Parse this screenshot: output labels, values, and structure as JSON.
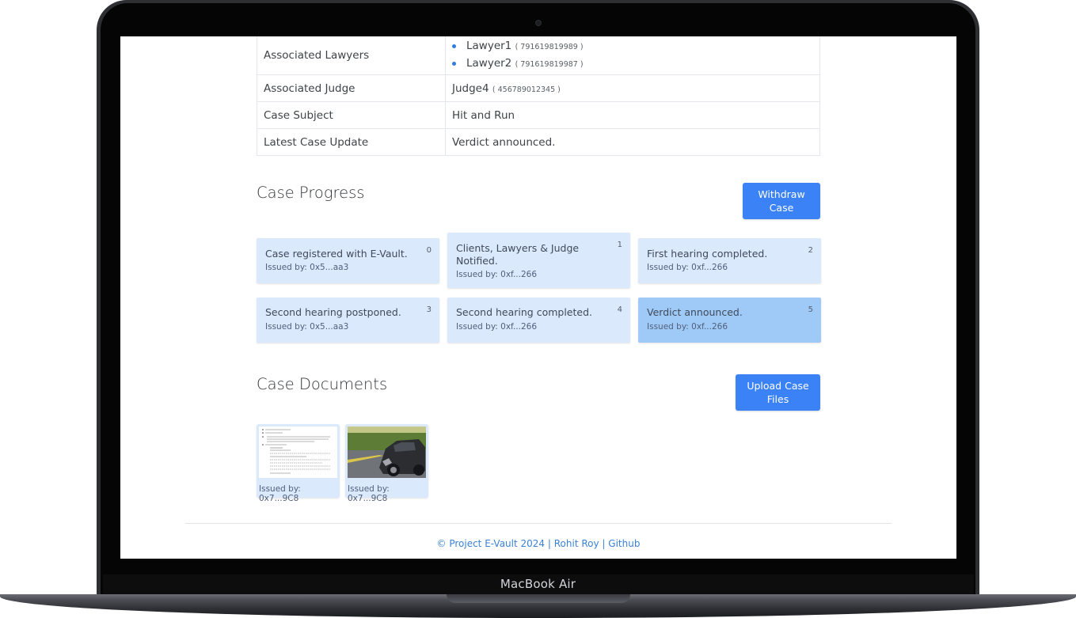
{
  "device": {
    "brand_label": "MacBook Air"
  },
  "case_details": {
    "rows": [
      {
        "label": "Associated Lawyers"
      },
      {
        "label": "Associated Judge",
        "name": "Judge4",
        "id": "( 456789012345 )"
      },
      {
        "label": "Case Subject",
        "value": "Hit and Run"
      },
      {
        "label": "Latest Case Update",
        "value": "Verdict announced."
      }
    ],
    "lawyers": [
      {
        "name": "Lawyer1",
        "id": "( 791619819989 )"
      },
      {
        "name": "Lawyer2",
        "id": "( 791619819987 )"
      }
    ]
  },
  "progress": {
    "title": "Case Progress",
    "withdraw_label_line1": "Withdraw",
    "withdraw_label_line2": "Case",
    "items": [
      {
        "text": "Case registered with E-Vault.",
        "issuer": "Issued by: 0x5...aa3",
        "index": "0"
      },
      {
        "text": "Clients, Lawyers & Judge Notified.",
        "issuer": "Issued by: 0xf...266",
        "index": "1"
      },
      {
        "text": "First hearing completed.",
        "issuer": "Issued by: 0xf...266",
        "index": "2"
      },
      {
        "text": "Second hearing postponed.",
        "issuer": "Issued by: 0x5...aa3",
        "index": "3"
      },
      {
        "text": "Second hearing completed.",
        "issuer": "Issued by: 0xf...266",
        "index": "4"
      },
      {
        "text": "Verdict announced.",
        "issuer": "Issued by: 0xf...266",
        "index": "5"
      }
    ]
  },
  "documents": {
    "title": "Case Documents",
    "upload_label_line1": "Upload Case",
    "upload_label_line2": "Files",
    "files": [
      {
        "issuer": "Issued by: 0x7...9C8",
        "icon": "document-thumbnail"
      },
      {
        "issuer": "Issued by: 0x7...9C8",
        "icon": "car-crash-photo"
      }
    ]
  },
  "footer": {
    "copyright": "© Project E-Vault 2024",
    "separator": "|",
    "author_link": "Rohit Roy",
    "github_link": "Github"
  },
  "colors": {
    "accent": "#3b82f6",
    "card_bg": "#dbe9fc",
    "card_active_bg": "#9fcaf7",
    "link": "#3b82d6"
  }
}
